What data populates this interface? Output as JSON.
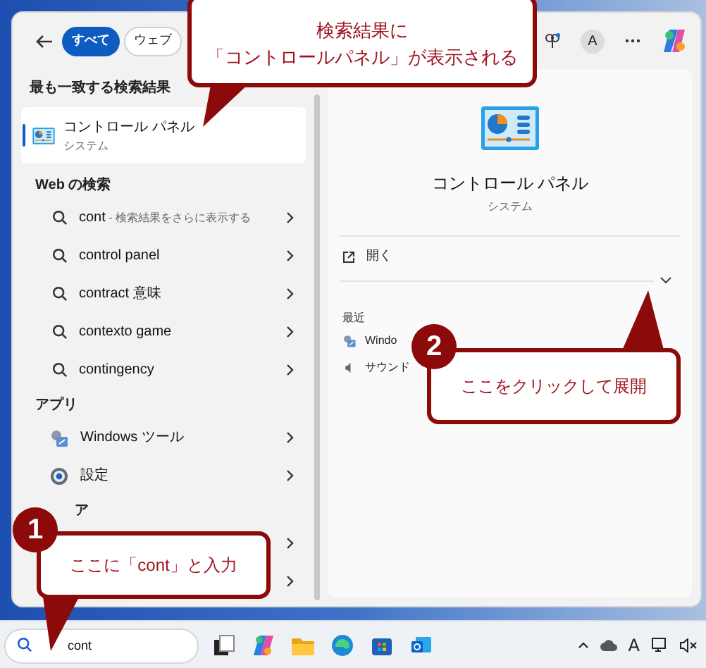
{
  "tabs": [
    {
      "label": "すべて",
      "selected": true
    },
    {
      "label": "ウェブ",
      "selected": false
    }
  ],
  "account": {
    "initial": "A"
  },
  "best_match": {
    "heading": "最も一致する検索結果",
    "title": "コントロール パネル",
    "subtitle": "システム",
    "selected": true
  },
  "web": {
    "heading": "Web の検索",
    "items": [
      {
        "query": "cont",
        "hint": "- 検索結果をさらに表示する"
      },
      {
        "query": "control panel"
      },
      {
        "query": "contract 意味"
      },
      {
        "query": "contexto game"
      },
      {
        "query": "contingency"
      }
    ]
  },
  "apps": {
    "heading": "アプリ",
    "items": [
      {
        "label": "Windows ツール",
        "kind": "tools"
      },
      {
        "label": "設定",
        "kind": "settings"
      }
    ]
  },
  "section_3": {
    "heading": "ア"
  },
  "detail": {
    "title": "コントロール パネル",
    "subtitle": "システム",
    "actions": [
      {
        "label": "開く"
      }
    ],
    "expanded": false,
    "recent_heading": "最近",
    "recent": [
      {
        "label": "Windo",
        "kind": "tools"
      },
      {
        "label": "サウンド",
        "kind": "sound"
      }
    ]
  },
  "callouts": [
    {
      "lines": [
        "検索結果に",
        "「コントロールパネル」が表示される"
      ]
    },
    {
      "step": "2",
      "text": "ここをクリックして展開"
    },
    {
      "step": "1",
      "text": "ここに「cont」と入力"
    }
  ],
  "taskbar": {
    "search": {
      "value": "cont"
    },
    "ime": "A"
  }
}
